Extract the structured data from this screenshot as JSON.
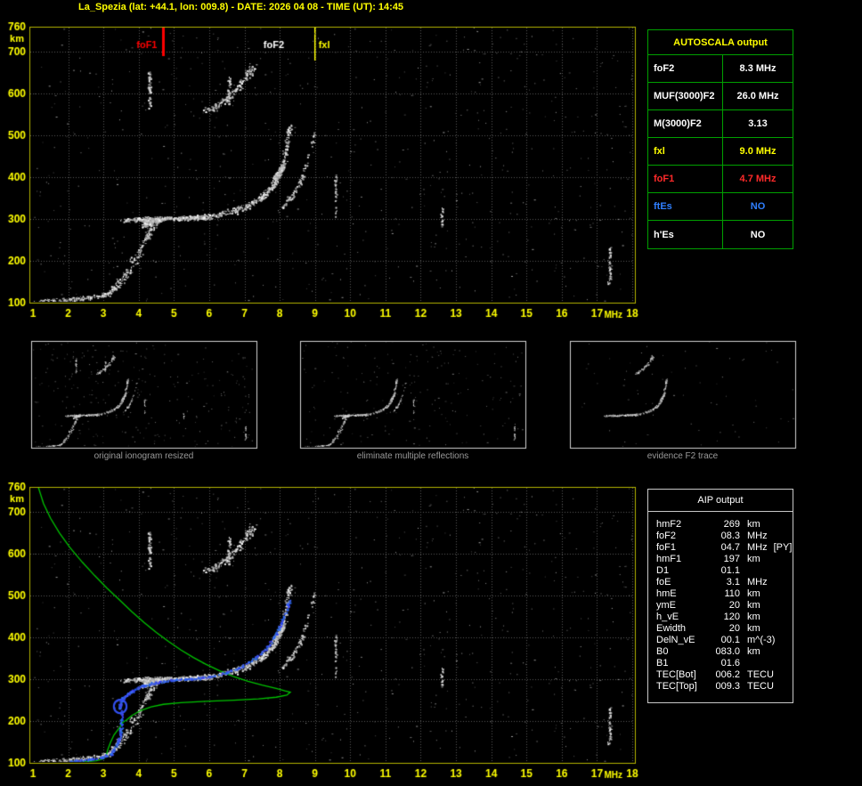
{
  "window": {
    "title": "La_Spezia (lat: +44.1, lon: 009.8) - DATE: 2026 04 08 - TIME (UT): 14:45"
  },
  "colors": {
    "background": "#000000",
    "axis": "#ffff00",
    "plot_border": "#b6b600",
    "grid": "#5a5a5a",
    "table_border_green": "#00a000",
    "table_border_white": "#c8c8c8",
    "caption_gray": "#9a9a9a",
    "red": "#ff0000",
    "blue": "#2f7fff",
    "white": "#ffffff",
    "profile_green": "#00c400",
    "trace_blue": "#3c50f0"
  },
  "autoscala": {
    "header": "AUTOSCALA output",
    "rows": [
      {
        "label": "foF2",
        "value": "8.3 MHz",
        "color": "#ffffff"
      },
      {
        "label": "MUF(3000)F2",
        "value": "26.0 MHz",
        "color": "#ffffff"
      },
      {
        "label": "M(3000)F2",
        "value": "3.13",
        "color": "#ffffff"
      },
      {
        "label": "fxl",
        "value": "9.0 MHz",
        "color": "#ffff00"
      },
      {
        "label": "foF1",
        "value": "4.7 MHz",
        "color": "#ff2a2a"
      },
      {
        "label": "ftEs",
        "value": "NO",
        "color": "#2f7fff"
      },
      {
        "label": "h'Es",
        "value": "NO",
        "color": "#ffffff"
      }
    ]
  },
  "aip": {
    "header": "AIP output",
    "rows": [
      {
        "label": "hmF2",
        "value": "269",
        "unit": "km",
        "note": ""
      },
      {
        "label": "foF2",
        "value": "08.3",
        "unit": "MHz",
        "note": ""
      },
      {
        "label": "foF1",
        "value": "04.7",
        "unit": "MHz",
        "note": "[PY]"
      },
      {
        "label": "hmF1",
        "value": "197",
        "unit": "km",
        "note": ""
      },
      {
        "label": "D1",
        "value": "01.1",
        "unit": "",
        "note": ""
      },
      {
        "label": "foE",
        "value": "3.1",
        "unit": "MHz",
        "note": ""
      },
      {
        "label": "hmE",
        "value": "110",
        "unit": "km",
        "note": ""
      },
      {
        "label": "ymE",
        "value": "20",
        "unit": "km",
        "note": ""
      },
      {
        "label": "h_vE",
        "value": "120",
        "unit": "km",
        "note": ""
      },
      {
        "label": "Ewidth",
        "value": "20",
        "unit": "km",
        "note": ""
      },
      {
        "label": "DelN_vE",
        "value": "00.1",
        "unit": "m^(-3)",
        "note": ""
      },
      {
        "label": "B0",
        "value": "083.0",
        "unit": "km",
        "note": ""
      },
      {
        "label": "B1",
        "value": "01.6",
        "unit": "",
        "note": ""
      },
      {
        "label": "TEC[Bot]",
        "value": "006.2",
        "unit": "TECU",
        "note": ""
      },
      {
        "label": "TEC[Top]",
        "value": "009.3",
        "unit": "TECU",
        "note": ""
      }
    ]
  },
  "thumbnails": [
    {
      "caption": "original ionogram resized",
      "bands": [
        "E",
        "F1riser",
        "F1blob",
        "band300",
        "F2",
        "F2blob",
        "Xmode",
        "hop2",
        "V1",
        "V2",
        "V3",
        "V4",
        "V5"
      ],
      "noise": 260
    },
    {
      "caption": "eliminate multiple reflections",
      "bands": [
        "E",
        "F1riser",
        "F1blob",
        "band300",
        "F2",
        "F2blob",
        "Xmode",
        "V3",
        "V5"
      ],
      "noise": 200
    },
    {
      "caption": "evidence F2 trace",
      "bands": [
        "band300",
        "F2",
        "F2blob",
        "hop2"
      ],
      "noise": 70
    }
  ],
  "chart_data": [
    {
      "id": "ionogram",
      "type": "scatter",
      "title": "La Spezia ionogram 2026-04-08 14:45 UT",
      "xlabel": "MHz",
      "ylabel": "km",
      "xlim": [
        1,
        18
      ],
      "ylim": [
        100,
        760
      ],
      "xticks": [
        1,
        2,
        3,
        4,
        5,
        6,
        7,
        8,
        9,
        10,
        11,
        12,
        13,
        14,
        15,
        16,
        17,
        18
      ],
      "yticks": [
        100,
        200,
        300,
        400,
        500,
        600,
        700,
        760
      ],
      "grid": true,
      "annotations": [
        {
          "label": "foF1",
          "x": 4.7,
          "color": "#ff0000",
          "tick": 33,
          "side": "right"
        },
        {
          "label": "foF2",
          "x": 8.3,
          "color": "#ffffff",
          "tick": 0,
          "side": "right"
        },
        {
          "label": "fxl",
          "x": 9.0,
          "color": "#ffff00",
          "tick": 38,
          "side": "left"
        }
      ],
      "traces": [
        {
          "name": "E",
          "points": [
            [
              1.1,
              104
            ],
            [
              1.8,
              107
            ],
            [
              2.4,
              111
            ],
            [
              2.9,
              117
            ],
            [
              3.2,
              125
            ]
          ],
          "count": 150,
          "jx": 0.12,
          "jy": 6,
          "seed": 11
        },
        {
          "name": "F1riser",
          "points": [
            [
              3.25,
              132
            ],
            [
              3.5,
              152
            ],
            [
              3.75,
              182
            ],
            [
              3.95,
              214
            ],
            [
              4.15,
              248
            ],
            [
              4.3,
              274
            ],
            [
              4.45,
              290
            ]
          ],
          "count": 170,
          "jx": 0.14,
          "jy": 10,
          "seed": 12
        },
        {
          "name": "F1blob",
          "points": [
            [
              4.1,
              286
            ],
            [
              4.35,
              296
            ],
            [
              4.6,
              300
            ]
          ],
          "count": 160,
          "jx": 0.12,
          "jy": 9,
          "seed": 13
        },
        {
          "name": "band300",
          "points": [
            [
              3.6,
              298
            ],
            [
              4.4,
              301
            ],
            [
              5.2,
              303
            ],
            [
              5.9,
              305
            ]
          ],
          "count": 300,
          "jx": 0.16,
          "jy": 6,
          "seed": 14
        },
        {
          "name": "F2",
          "points": [
            [
              5.7,
              305
            ],
            [
              6.2,
              311
            ],
            [
              6.7,
              320
            ],
            [
              7.1,
              332
            ],
            [
              7.45,
              350
            ],
            [
              7.75,
              375
            ],
            [
              7.95,
              405
            ],
            [
              8.1,
              440
            ],
            [
              8.2,
              480
            ],
            [
              8.28,
              525
            ]
          ],
          "count": 380,
          "jx": 0.09,
          "jy": 9,
          "seed": 15
        },
        {
          "name": "F2blob",
          "points": [
            [
              7.85,
              395
            ],
            [
              8.05,
              425
            ]
          ],
          "count": 90,
          "jx": 0.09,
          "jy": 12,
          "seed": 16
        },
        {
          "name": "Xmode",
          "points": [
            [
              8.05,
              330
            ],
            [
              8.35,
              358
            ],
            [
              8.6,
              395
            ],
            [
              8.8,
              445
            ],
            [
              8.95,
              505
            ]
          ],
          "count": 90,
          "jx": 0.07,
          "jy": 8,
          "seed": 17
        },
        {
          "name": "hop2",
          "points": [
            [
              5.9,
              556
            ],
            [
              6.2,
              570
            ],
            [
              6.5,
              589
            ],
            [
              6.8,
              613
            ],
            [
              7.05,
              642
            ],
            [
              7.25,
              668
            ]
          ],
          "count": 170,
          "jx": 0.12,
          "jy": 10,
          "seed": 18
        },
        {
          "name": "V1",
          "points": [
            [
              4.3,
              565
            ],
            [
              4.3,
              655
            ]
          ],
          "count": 60,
          "jx": 0.05,
          "jy": 12,
          "seed": 19
        },
        {
          "name": "V2",
          "points": [
            [
              6.55,
              575
            ],
            [
              6.55,
              640
            ]
          ],
          "count": 35,
          "jx": 0.05,
          "jy": 10,
          "seed": 20
        },
        {
          "name": "V3",
          "points": [
            [
              17.35,
              150
            ],
            [
              17.35,
              235
            ]
          ],
          "count": 55,
          "jx": 0.06,
          "jy": 10,
          "seed": 21
        },
        {
          "name": "V4",
          "points": [
            [
              12.6,
              285
            ],
            [
              12.6,
              330
            ]
          ],
          "count": 22,
          "jx": 0.05,
          "jy": 8,
          "seed": 22
        },
        {
          "name": "V5",
          "points": [
            [
              9.58,
              310
            ],
            [
              9.58,
              405
            ]
          ],
          "count": 35,
          "jx": 0.05,
          "jy": 9,
          "seed": 23
        }
      ],
      "noise": {
        "count": 650,
        "seed": 61
      }
    },
    {
      "id": "restored",
      "type": "scatter",
      "title": "ionogram with AIP restored profile and fitted trace",
      "xlabel": "MHz",
      "ylabel": "km",
      "xlim": [
        1,
        18
      ],
      "ylim": [
        100,
        760
      ],
      "xticks": [
        1,
        2,
        3,
        4,
        5,
        6,
        7,
        8,
        9,
        10,
        11,
        12,
        13,
        14,
        15,
        16,
        17,
        18
      ],
      "yticks": [
        100,
        200,
        300,
        400,
        500,
        600,
        700,
        760
      ],
      "grid": true,
      "annotations": [],
      "profile_curve": {
        "color": "#00c400",
        "points": [
          [
            1.15,
            760
          ],
          [
            1.3,
            720
          ],
          [
            1.5,
            685
          ],
          [
            1.75,
            650
          ],
          [
            2.05,
            615
          ],
          [
            2.4,
            580
          ],
          [
            2.75,
            548
          ],
          [
            3.1,
            518
          ],
          [
            3.45,
            490
          ],
          [
            3.8,
            462
          ],
          [
            4.15,
            436
          ],
          [
            4.5,
            412
          ],
          [
            4.85,
            390
          ],
          [
            5.2,
            370
          ],
          [
            5.55,
            352
          ],
          [
            5.9,
            336
          ],
          [
            6.3,
            320
          ],
          [
            6.7,
            306
          ],
          [
            7.1,
            295
          ],
          [
            7.5,
            286
          ],
          [
            7.9,
            278
          ],
          [
            8.15,
            272
          ],
          [
            8.3,
            269
          ],
          [
            8.2,
            262
          ],
          [
            7.9,
            257
          ],
          [
            7.4,
            253
          ],
          [
            6.7,
            250
          ],
          [
            5.9,
            247
          ],
          [
            5.2,
            244
          ],
          [
            4.7,
            240
          ],
          [
            4.35,
            234
          ],
          [
            4.05,
            225
          ],
          [
            3.8,
            213
          ],
          [
            3.65,
            202
          ],
          [
            3.55,
            197
          ],
          [
            3.45,
            184
          ],
          [
            3.3,
            167
          ],
          [
            3.2,
            149
          ],
          [
            3.12,
            131
          ],
          [
            3.08,
            117
          ],
          [
            3.0,
            110
          ],
          [
            2.8,
            105
          ],
          [
            2.4,
            102
          ],
          [
            2.0,
            100
          ],
          [
            1.6,
            100
          ]
        ]
      },
      "fitted_trace": {
        "color": "#3c50f0",
        "points": [
          [
            2.0,
            104
          ],
          [
            2.5,
            108
          ],
          [
            2.9,
            113
          ],
          [
            3.2,
            122
          ],
          [
            3.35,
            140
          ],
          [
            3.45,
            165
          ],
          [
            3.5,
            190
          ],
          [
            3.5,
            215
          ],
          [
            3.45,
            235
          ],
          [
            3.5,
            252
          ],
          [
            3.65,
            265
          ],
          [
            3.85,
            276
          ],
          [
            4.1,
            285
          ],
          [
            4.4,
            292
          ],
          [
            4.75,
            297
          ],
          [
            5.1,
            300
          ],
          [
            5.45,
            302
          ],
          [
            5.8,
            305
          ],
          [
            6.15,
            310
          ],
          [
            6.5,
            318
          ],
          [
            6.85,
            329
          ],
          [
            7.15,
            343
          ],
          [
            7.45,
            362
          ],
          [
            7.7,
            386
          ],
          [
            7.9,
            413
          ],
          [
            8.05,
            440
          ],
          [
            8.18,
            465
          ],
          [
            8.27,
            490
          ]
        ],
        "loop": {
          "cx": 3.45,
          "cy": 237,
          "rx": 0.18,
          "ry": 16
        }
      },
      "noise": {
        "count": 650,
        "seed": 61
      }
    }
  ]
}
